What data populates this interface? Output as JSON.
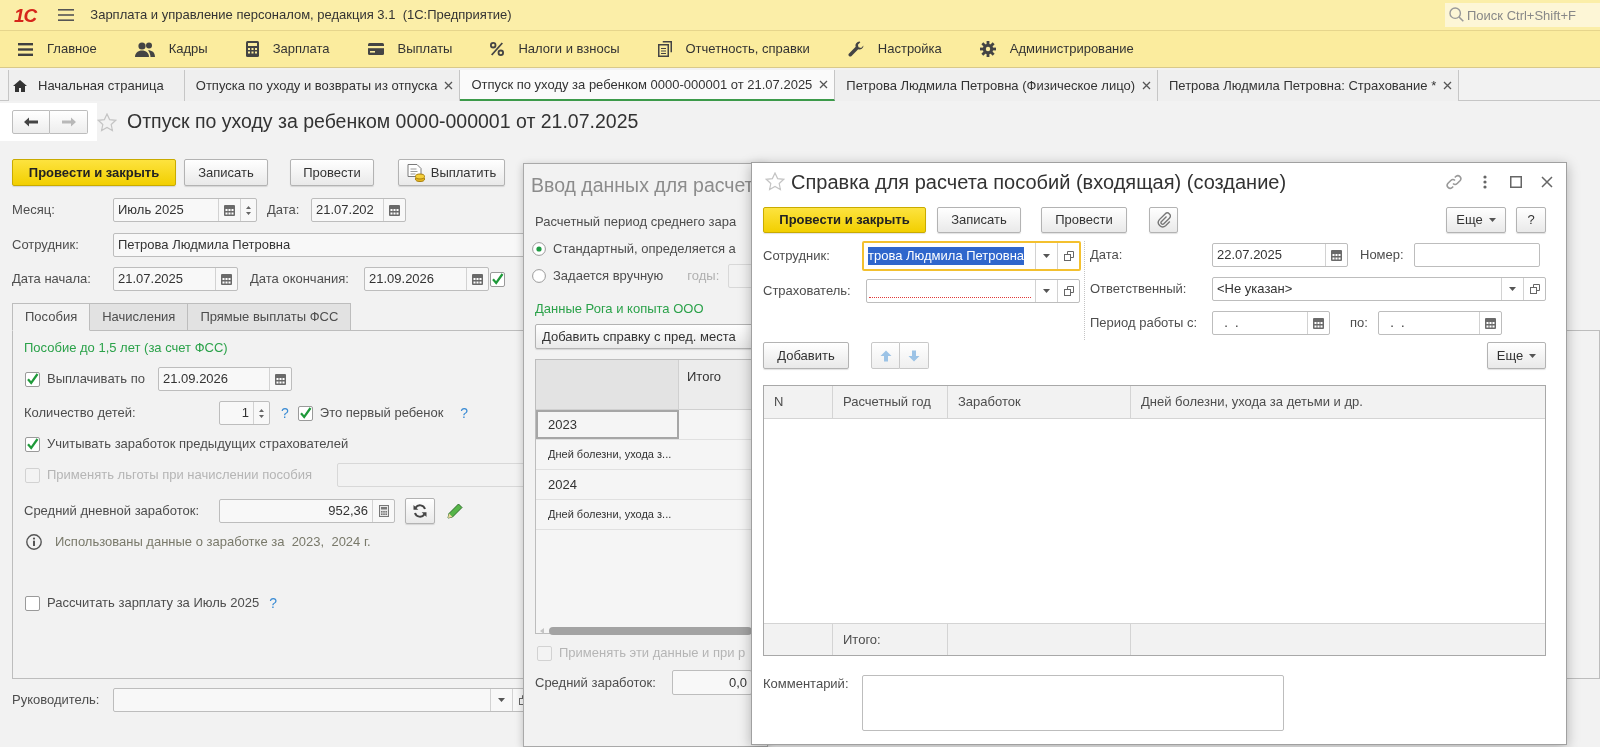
{
  "app": {
    "logo": "1С",
    "title": "Зарплата и управление персоналом, редакция 3.1  (1С:Предприятие)",
    "search": {
      "placeholder": "Поиск Ctrl+Shift+F"
    }
  },
  "sections": [
    {
      "label": "Главное"
    },
    {
      "label": "Кадры"
    },
    {
      "label": "Зарплата"
    },
    {
      "label": "Выплаты"
    },
    {
      "label": "Налоги и взносы"
    },
    {
      "label": "Отчетность, справки"
    },
    {
      "label": "Настройка"
    },
    {
      "label": "Администрирование"
    }
  ],
  "tabs": [
    {
      "label": "Начальная страница",
      "kind": "home",
      "selected": false
    },
    {
      "label": "Отпуска по уходу и возвраты из отпуска",
      "kind": "form",
      "selected": false
    },
    {
      "label": "Отпуск по уходу за ребенком 0000-000001 от 21.07.2025",
      "kind": "form",
      "selected": true
    },
    {
      "label": "Петрова Людмила Петровна (Физическое лицо)",
      "kind": "form",
      "selected": false
    },
    {
      "label": "Петрова Людмила Петровна: Страхование *",
      "kind": "form",
      "selected": false
    }
  ],
  "document": {
    "title": "Отпуск по уходу за ребенком 0000-000001 от 21.07.2025",
    "commands": [
      {
        "label": "Провести и закрыть",
        "kind": "default"
      },
      {
        "label": "Записать",
        "kind": "plain"
      },
      {
        "label": "Провести",
        "kind": "plain"
      },
      {
        "label": "Выплатить",
        "kind": "icon"
      }
    ],
    "month": {
      "label": "Месяц:",
      "value": "Июль 2025"
    },
    "date": {
      "label": "Дата:",
      "value": "21.07.202"
    },
    "employee": {
      "label": "Сотрудник:",
      "value": "Петрова Людмила Петровна"
    },
    "start": {
      "label": "Дата начала:",
      "value": "21.07.2025"
    },
    "end": {
      "label": "Дата окончания:",
      "value": "21.09.2026",
      "checked": true
    },
    "tabs": [
      {
        "label": "Пособия",
        "selected": true
      },
      {
        "label": "Начисления",
        "selected": false
      },
      {
        "label": "Прямые выплаты ФСС",
        "selected": false
      }
    ],
    "benefit": {
      "heading": "Пособие до 1,5 лет (за счет ФСС)",
      "pay_until": {
        "label": "Выплачивать по",
        "checked": true,
        "value": "21.09.2026"
      },
      "children": {
        "label": "Количество детей:",
        "value": "1",
        "help": "?"
      },
      "first_child": {
        "label": "Это первый ребенок",
        "checked": true,
        "help": "?"
      },
      "prev_insurers": {
        "label": "Учитывать заработок предыдущих страхователей",
        "checked": true
      },
      "relief": {
        "label": "Применять льготы при начислении пособия",
        "checked": false,
        "disabled": true
      },
      "avg_daily": {
        "label": "Средний дневной заработок:",
        "value": "952,36"
      },
      "info": "Использованы данные о заработке за  2023,  2024 г.",
      "calc_salary": {
        "label": "Рассчитать зарплату за Июль 2025",
        "checked": false,
        "help": "?"
      }
    },
    "manager": {
      "label": "Руководитель:"
    }
  },
  "calc_dialog": {
    "title": "Ввод данных для расчет",
    "period_label": "Расчетный период среднего зара",
    "options": [
      {
        "label": "Стандартный, определяется а",
        "selected": true
      },
      {
        "label": "Задается вручную",
        "selected": false
      }
    ],
    "years": {
      "label": "годы:",
      "disabled": true
    },
    "org": "Данные Рога и копыта ООО",
    "add_button": "Добавить справку с пред. места",
    "table": {
      "columns": [
        "Итого"
      ],
      "rows": [
        {
          "label": "2023",
          "kind": "year",
          "selected": true
        },
        {
          "label": "Дней болезни, ухода з...",
          "kind": "detail",
          "selected": false
        },
        {
          "label": "2024",
          "kind": "year",
          "selected": false
        },
        {
          "label": "Дней болезни, ухода з...",
          "kind": "detail",
          "selected": false
        }
      ]
    },
    "apply": {
      "label": "Применять эти данные и при р",
      "checked": false,
      "disabled": true
    },
    "average": {
      "label": "Средний заработок:",
      "value": "0,0"
    }
  },
  "certificate": {
    "title": "Справка для расчета пособий (входящая) (создание)",
    "commands": [
      {
        "label": "Провести и закрыть",
        "kind": "default"
      },
      {
        "label": "Записать",
        "kind": "plain"
      },
      {
        "label": "Провести",
        "kind": "plain"
      },
      {
        "kind": "attach"
      }
    ],
    "more": "Еще",
    "help": "?",
    "employee": {
      "label": "Сотрудник:",
      "value": "трова Людмила Петровна",
      "focused": true
    },
    "insurer": {
      "label": "Страхователь:",
      "required": true
    },
    "date": {
      "label": "Дата:",
      "value": "22.07.2025"
    },
    "number": {
      "label": "Номер:"
    },
    "responsible": {
      "label": "Ответственный:",
      "value": "<Не указан>"
    },
    "period": {
      "label": "Период работы с:",
      "from": "  .  .",
      "to_label": "по:",
      "to": "  .  ."
    },
    "table_commands": {
      "add": "Добавить",
      "more": "Еще"
    },
    "table": {
      "columns": [
        "N",
        "Расчетный год",
        "Заработок",
        "Дней болезни, ухода за детьми и др."
      ],
      "total_label": "Итого:"
    },
    "comment": {
      "label": "Комментарий:"
    }
  }
}
